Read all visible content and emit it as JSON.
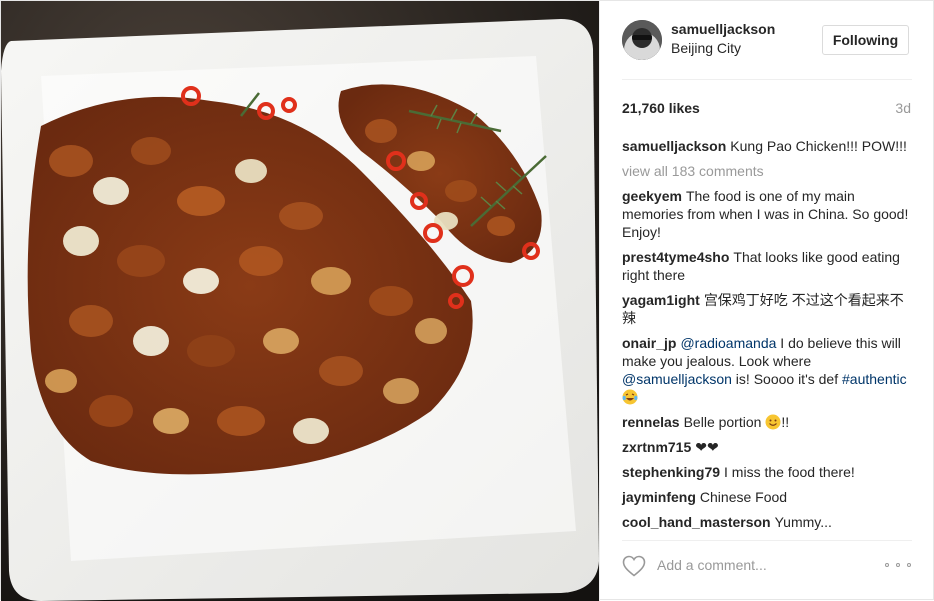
{
  "post": {
    "image_alt": "Kung Pao Chicken on a white square plate",
    "header": {
      "username": "samuelljackson",
      "location": "Beijing City",
      "follow_label": "Following"
    },
    "likes": "21,760 likes",
    "time": "3d",
    "caption": {
      "author": "samuelljackson",
      "text": "Kung Pao Chicken!!! POW!!!"
    },
    "view_all": "view all 183 comments",
    "comments": [
      {
        "author": "geekyem",
        "text": "The food is one of my main memories from when I was in China. So good! Enjoy!"
      },
      {
        "author": "prest4tyme4sho",
        "text": "That looks like good eating right there"
      },
      {
        "author": "yagam1ight",
        "text": "宫保鸡丁好吃 不过这个看起来不辣"
      },
      {
        "author": "onair_jp",
        "mention1": "@radioamanda",
        "text1": " I do believe this will make you jealous. Look where ",
        "mention2": "@samuelljackson",
        "text2": " is! Soooo it's def ",
        "hashtag": "#authentic",
        "emoji": "laughing-tears-emoji"
      },
      {
        "author": "rennelas",
        "text": "Belle portion ",
        "emoji": "smile-emoji",
        "text_after": "!!"
      },
      {
        "author": "zxrtnm715",
        "text": "❤❤"
      },
      {
        "author": "stephenking79",
        "text": "I miss the food there!"
      },
      {
        "author": "jayminfeng",
        "text": "Chinese Food"
      },
      {
        "author": "cool_hand_masterson",
        "text": "Yummy..."
      }
    ],
    "footer": {
      "heart_icon": "heart-outline-icon",
      "add_comment_placeholder": "Add a comment...",
      "more_icon": "more-options-icon"
    },
    "colors": {
      "link": "#003569",
      "muted": "#999999",
      "text": "#262626",
      "border": "#dbdbdb"
    }
  }
}
